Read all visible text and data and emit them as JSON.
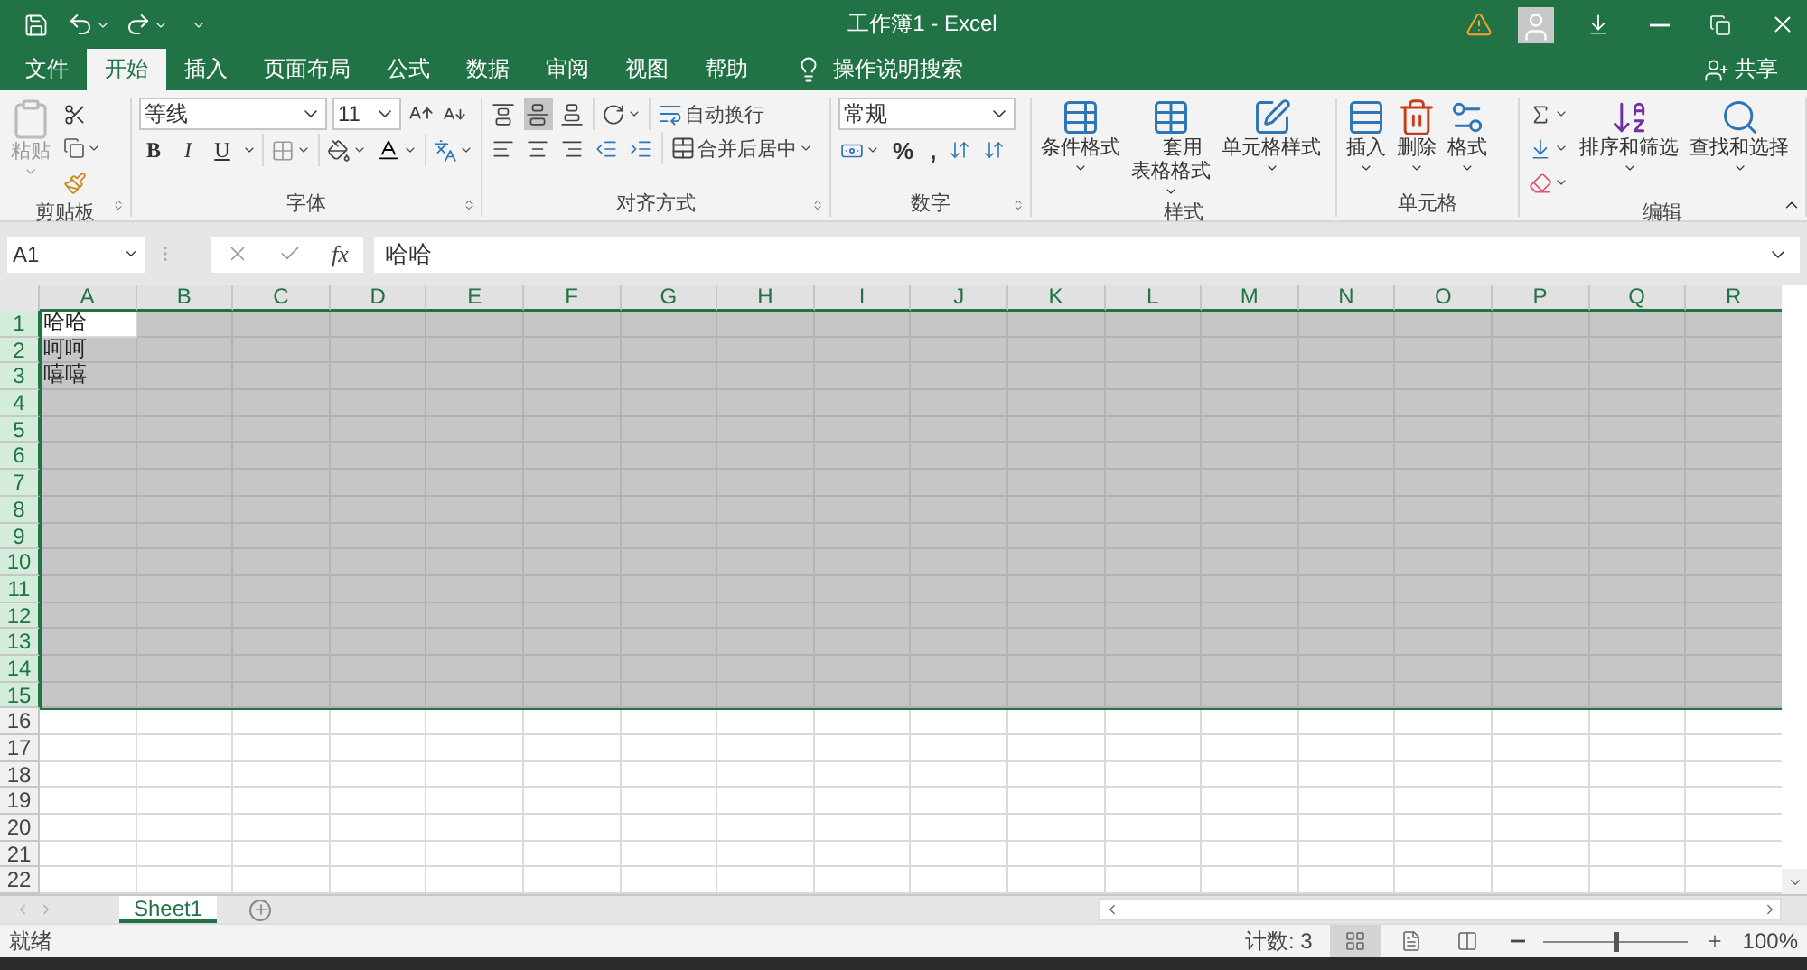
{
  "title_bar": {
    "title": "工作簿1 - Excel"
  },
  "ribbon_tabs": [
    {
      "label": "文件",
      "selected": false
    },
    {
      "label": "开始",
      "selected": true
    },
    {
      "label": "插入",
      "selected": false
    },
    {
      "label": "页面布局",
      "selected": false
    },
    {
      "label": "公式",
      "selected": false
    },
    {
      "label": "数据",
      "selected": false
    },
    {
      "label": "审阅",
      "selected": false
    },
    {
      "label": "视图",
      "selected": false
    },
    {
      "label": "帮助",
      "selected": false
    }
  ],
  "tell_me": {
    "label": "操作说明搜索"
  },
  "share": {
    "label": "共享"
  },
  "clipboard": {
    "label": "剪贴板",
    "paste": "粘贴",
    "paste_disabled": true
  },
  "font": {
    "label": "字体",
    "font_name": "等线",
    "font_size": "11",
    "styles": [
      "B",
      "I",
      "U"
    ]
  },
  "alignment": {
    "label": "对齐方式",
    "vertical": [
      {
        "kind": "top",
        "selected": false
      },
      {
        "kind": "middle",
        "selected": true
      },
      {
        "kind": "bottom",
        "selected": false
      }
    ],
    "wrap_text": "自动换行",
    "merge": "合并后居中"
  },
  "number": {
    "label": "数字",
    "format": "常规",
    "symbols": [
      "%",
      ","
    ]
  },
  "styles": {
    "label": "样式",
    "buttons": [
      {
        "kind": "conditional",
        "label": "条件格式"
      },
      {
        "kind": "table",
        "label": "套用表格格式"
      },
      {
        "kind": "cell_style",
        "label": "单元格样式"
      }
    ]
  },
  "cells": {
    "label": "单元格",
    "buttons": [
      {
        "kind": "insert",
        "label": "插入"
      },
      {
        "kind": "delete",
        "label": "删除"
      },
      {
        "kind": "format",
        "label": "格式"
      }
    ]
  },
  "editing": {
    "label": "编辑",
    "buttons": [
      {
        "kind": "sort",
        "label": "排序和筛选"
      },
      {
        "kind": "find",
        "label": "查找和选择"
      }
    ]
  },
  "formula_bar": {
    "name_box": "A1",
    "function_label": "fx",
    "value": "哈哈"
  },
  "grid": {
    "columns": [
      {
        "label": "A",
        "selected": true
      },
      {
        "label": "B",
        "selected": true
      },
      {
        "label": "C",
        "selected": true
      },
      {
        "label": "D",
        "selected": true
      },
      {
        "label": "E",
        "selected": true
      },
      {
        "label": "F",
        "selected": true
      },
      {
        "label": "G",
        "selected": true
      },
      {
        "label": "H",
        "selected": true
      },
      {
        "label": "I",
        "selected": true
      },
      {
        "label": "J",
        "selected": true
      },
      {
        "label": "K",
        "selected": true
      },
      {
        "label": "L",
        "selected": true
      },
      {
        "label": "M",
        "selected": true
      },
      {
        "label": "N",
        "selected": true
      },
      {
        "label": "O",
        "selected": true
      },
      {
        "label": "P",
        "selected": true
      },
      {
        "label": "Q",
        "selected": true
      },
      {
        "label": "R",
        "selected": true
      }
    ],
    "rows": [
      {
        "header": "1",
        "selected": true,
        "cells": [
          {
            "text": "哈哈",
            "active": true
          }
        ]
      },
      {
        "header": "2",
        "selected": true,
        "cells": [
          {
            "text": "呵呵",
            "active": false
          }
        ]
      },
      {
        "header": "3",
        "selected": true,
        "cells": [
          {
            "text": "嘻嘻",
            "active": false
          }
        ]
      },
      {
        "header": "4",
        "selected": true
      },
      {
        "header": "5",
        "selected": true
      },
      {
        "header": "6",
        "selected": true
      },
      {
        "header": "7",
        "selected": true
      },
      {
        "header": "8",
        "selected": true
      },
      {
        "header": "9",
        "selected": true
      },
      {
        "header": "10",
        "selected": true
      },
      {
        "header": "11",
        "selected": true
      },
      {
        "header": "12",
        "selected": true
      },
      {
        "header": "13",
        "selected": true
      },
      {
        "header": "14",
        "selected": true
      },
      {
        "header": "15",
        "selected": true
      },
      {
        "header": "16",
        "selected": false
      },
      {
        "header": "17",
        "selected": false
      },
      {
        "header": "18",
        "selected": false
      },
      {
        "header": "19",
        "selected": false
      },
      {
        "header": "20",
        "selected": false
      },
      {
        "header": "21",
        "selected": false
      },
      {
        "header": "22",
        "selected": false
      }
    ]
  },
  "sheet_tabs": [
    {
      "label": "Sheet1",
      "selected": true
    }
  ],
  "status_bar": {
    "mode": "就绪",
    "count": "计数: 3",
    "views": [
      {
        "kind": "normal",
        "selected": true
      },
      {
        "kind": "page_layout",
        "selected": false
      },
      {
        "kind": "page_break",
        "selected": false
      }
    ],
    "zoom_slider": {
      "level": 0.5
    },
    "zoom": "100%"
  }
}
